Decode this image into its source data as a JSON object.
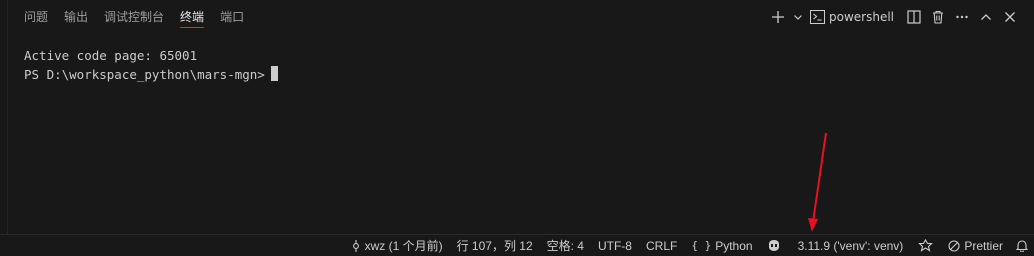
{
  "tabs": [
    {
      "label": "问题",
      "active": false
    },
    {
      "label": "输出",
      "active": false
    },
    {
      "label": "调试控制台",
      "active": false
    },
    {
      "label": "终端",
      "active": true
    },
    {
      "label": "端口",
      "active": false
    }
  ],
  "actions": {
    "shell_label": "powershell"
  },
  "terminal": {
    "lines": [
      "Active code page: 65001",
      "PS D:\\workspace_python\\mars-mgn>"
    ]
  },
  "statusbar": {
    "git": "xwz (1 个月前)",
    "position": "行 107，列 12",
    "indent": "空格: 4",
    "encoding": "UTF-8",
    "eol": "CRLF",
    "language": "Python",
    "interpreter": "3.11.9 ('venv': venv)",
    "formatter": "Prettier"
  },
  "colors": {
    "background": "#181818",
    "accent": "#0078d4",
    "annotation_arrow": "#e81123"
  }
}
